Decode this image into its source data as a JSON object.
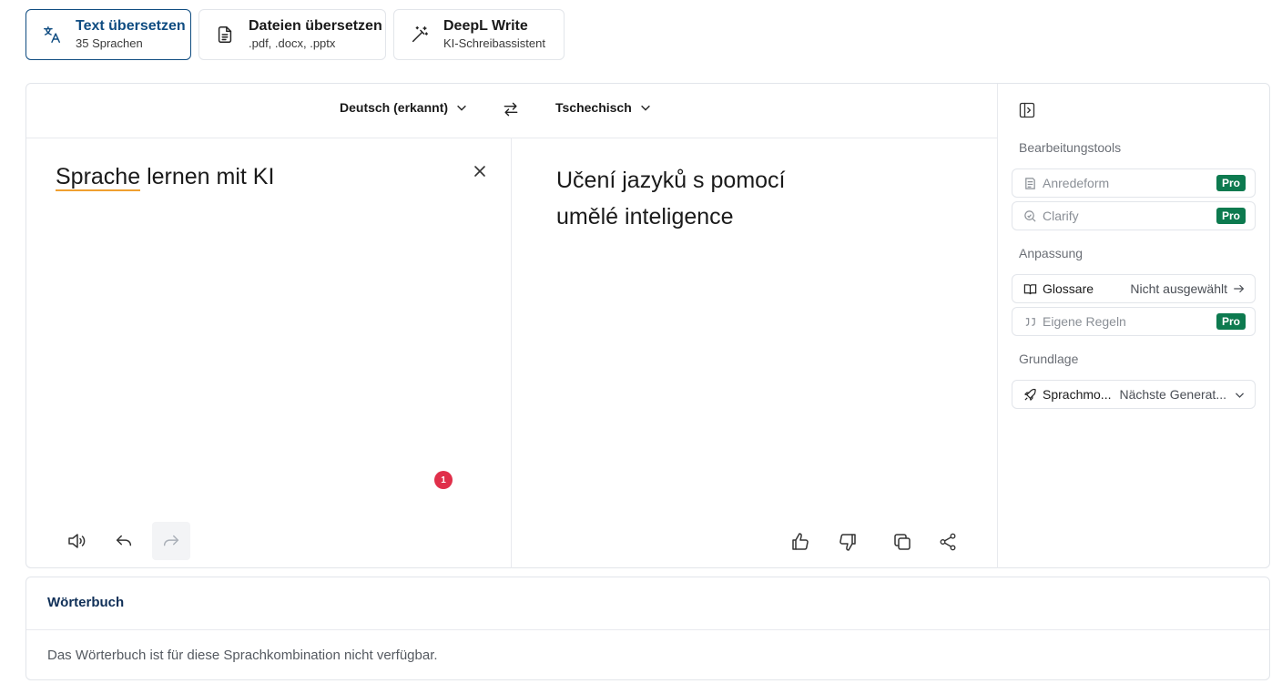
{
  "tabs": [
    {
      "title": "Text übersetzen",
      "subtitle": "35 Sprachen",
      "icon": "translate-icon",
      "active": true
    },
    {
      "title": "Dateien übersetzen",
      "subtitle": ".pdf, .docx, .pptx",
      "icon": "document-icon",
      "active": false
    },
    {
      "title": "DeepL Write",
      "subtitle": "KI-Schreibassistent",
      "icon": "magic-wand-icon",
      "active": false
    }
  ],
  "languages": {
    "source": "Deutsch (erkannt)",
    "target": "Tschechisch"
  },
  "source": {
    "text_underlined": "Sprache",
    "text_rest": " lernen mit KI",
    "badge_count": "1"
  },
  "target": {
    "line1": "Učení jazyků s pomocí",
    "line2": "umělé inteligence"
  },
  "side": {
    "section1": "Bearbeitungstools",
    "anredeform": "Anredeform",
    "clarify": "Clarify",
    "pro": "Pro",
    "section2": "Anpassung",
    "glossare": "Glossare",
    "glossare_value": "Nicht ausgewählt",
    "eigene_regeln": "Eigene Regeln",
    "section3": "Grundlage",
    "sprachmodell": "Sprachmo...",
    "sprachmodell_value": "Nächste Generat..."
  },
  "dictionary": {
    "title": "Wörterbuch",
    "message": "Das Wörterbuch ist für diese Sprachkombination nicht verfügbar."
  },
  "colors": {
    "accent": "#0f4c81",
    "pro_badge": "#0d7a4f",
    "notification": "#e02f4a",
    "underline": "#f0a030"
  }
}
